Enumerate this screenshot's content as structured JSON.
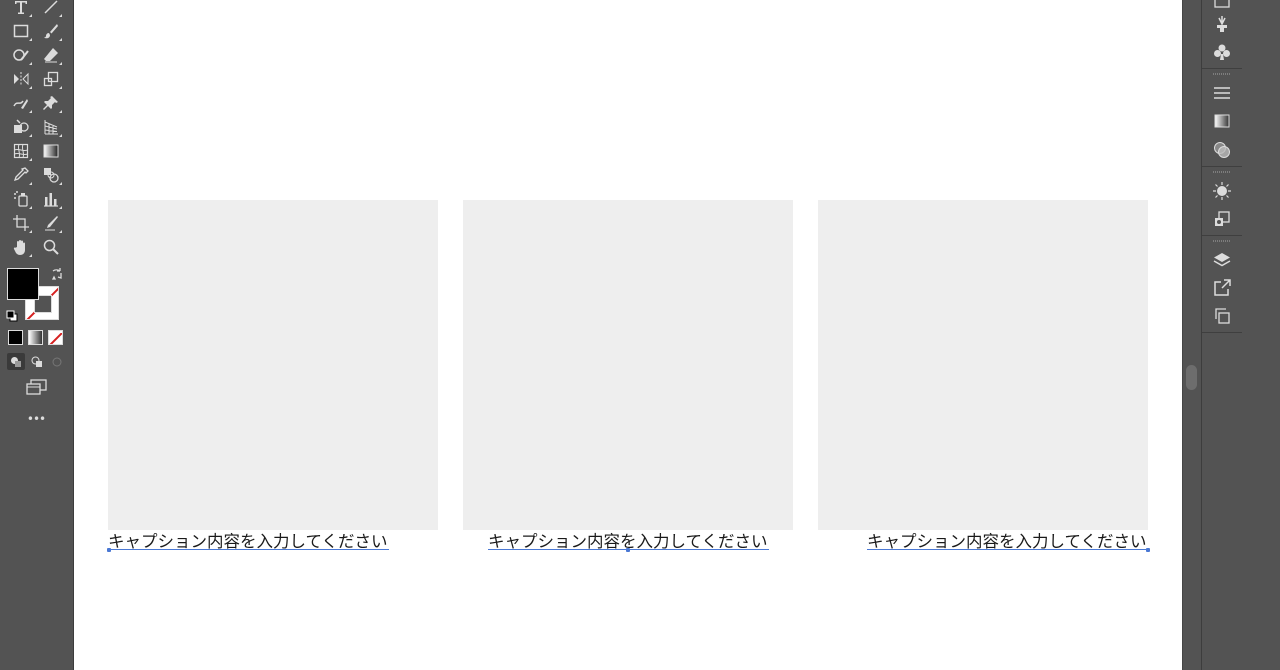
{
  "toolbar": {
    "tools": [
      "type-tool-icon",
      "line-segment-tool-icon",
      "rectangle-tool-icon",
      "paintbrush-tool-icon",
      "shaper-tool-icon",
      "eraser-tool-icon",
      "reflect-tool-icon",
      "scale-tool-icon",
      "warp-tool-icon",
      "puppet-warp-tool-icon",
      "shape-builder-tool-icon",
      "perspective-grid-tool-icon",
      "mesh-tool-icon",
      "gradient-tool-icon",
      "eyedropper-tool-icon",
      "blend-tool-icon",
      "symbol-sprayer-tool-icon",
      "column-graph-tool-icon",
      "artboard-tool-icon",
      "slice-tool-icon",
      "hand-tool-icon",
      "zoom-tool-icon"
    ],
    "more_label": "•••"
  },
  "canvas": {
    "captions": [
      "キャプション内容を入力してください",
      "キャプション内容を入力してください",
      "キャプション内容を入力してください"
    ]
  },
  "dock": {
    "icons": [
      "brushes-icon",
      "symbols-icon",
      "stroke-icon",
      "gradient-icon",
      "transparency-icon",
      "appearance-icon",
      "graphic-styles-icon",
      "layers-icon",
      "asset-export-icon",
      "artboards-icon"
    ]
  },
  "colors": {
    "ui_bg": "#535353",
    "canvas_bg": "#ffffff",
    "placeholder": "#eeeeee",
    "caption_underline": "#4a78d4",
    "fill": "#000000",
    "none_slash": "#d62020"
  }
}
